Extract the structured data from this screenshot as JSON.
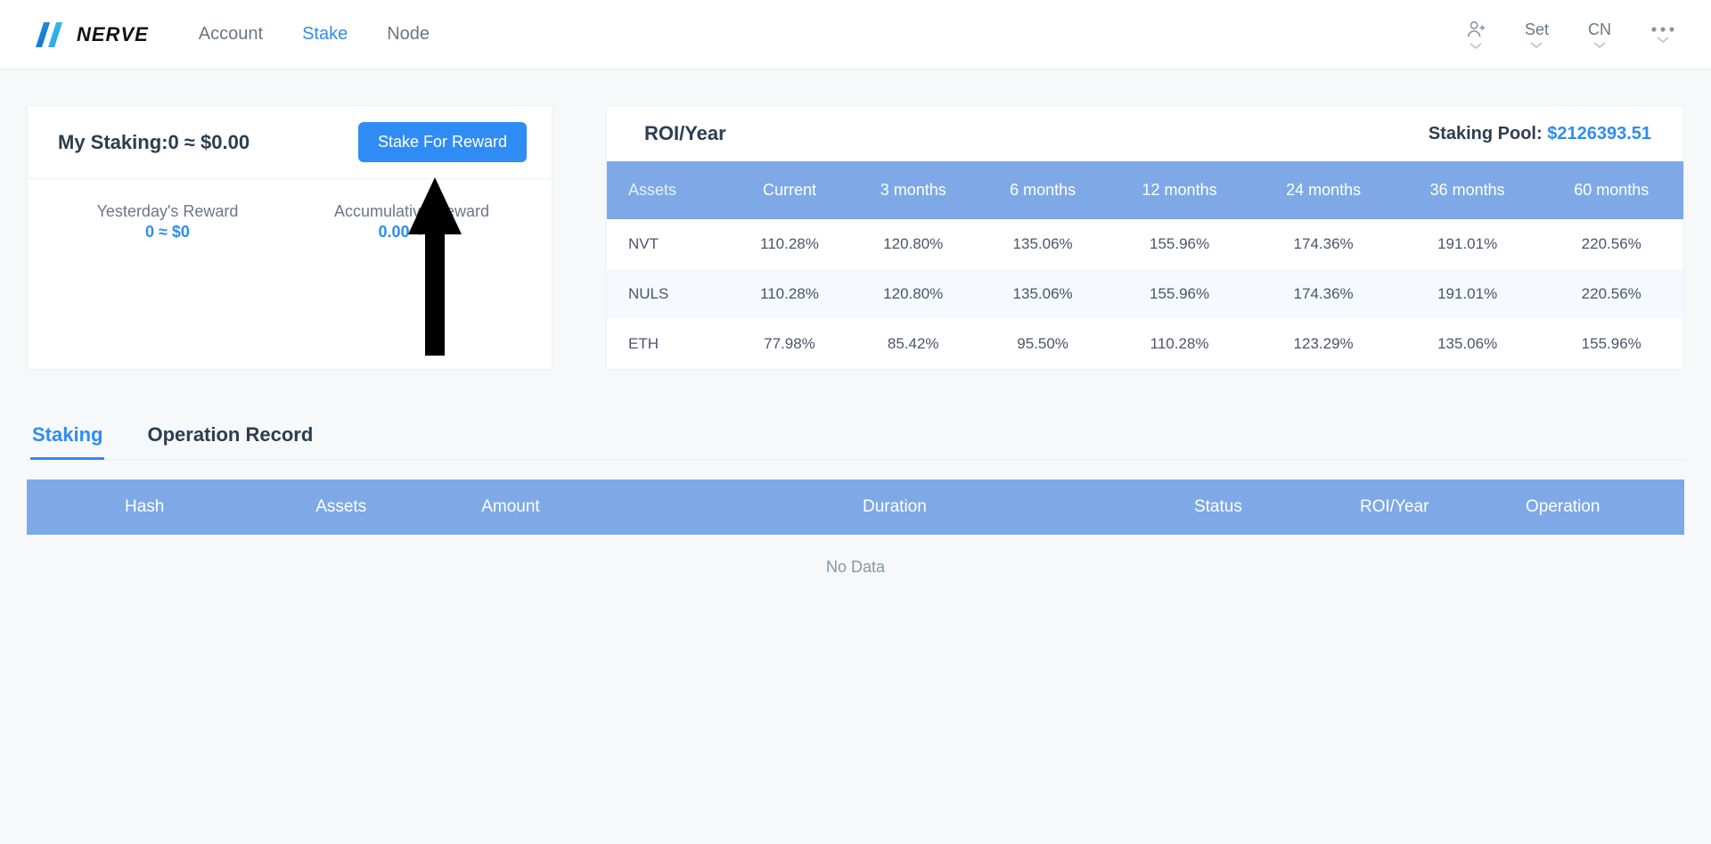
{
  "brand": {
    "name": "NERVE"
  },
  "nav": {
    "links": [
      {
        "label": "Account",
        "active": false
      },
      {
        "label": "Stake",
        "active": true
      },
      {
        "label": "Node",
        "active": false
      }
    ],
    "set": "Set",
    "lang": "CN"
  },
  "my_staking": {
    "title": "My Staking:0 ≈ $0.00",
    "button": "Stake For Reward",
    "yesterday_label": "Yesterday's Reward",
    "yesterday_value": "0 ≈ $0",
    "acc_label": "Accumulative Reward",
    "acc_value": "0.00 ≈ $0"
  },
  "roi": {
    "title": "ROI/Year",
    "pool_label": "Staking Pool: ",
    "pool_value": "$2126393.51",
    "headers": [
      "Assets",
      "Current",
      "3 months",
      "6 months",
      "12 months",
      "24 months",
      "36 months",
      "60 months"
    ],
    "rows": [
      {
        "asset": "NVT",
        "v": [
          "110.28%",
          "120.80%",
          "135.06%",
          "155.96%",
          "174.36%",
          "191.01%",
          "220.56%"
        ]
      },
      {
        "asset": "NULS",
        "v": [
          "110.28%",
          "120.80%",
          "135.06%",
          "155.96%",
          "174.36%",
          "191.01%",
          "220.56%"
        ]
      },
      {
        "asset": "ETH",
        "v": [
          "77.98%",
          "85.42%",
          "95.50%",
          "110.28%",
          "123.29%",
          "135.06%",
          "155.96%"
        ]
      }
    ]
  },
  "tabs": [
    {
      "label": "Staking",
      "active": true
    },
    {
      "label": "Operation Record",
      "active": false
    }
  ],
  "staking_table": {
    "headers": [
      "Hash",
      "Assets",
      "Amount",
      "Duration",
      "Status",
      "ROI/Year",
      "Operation"
    ],
    "empty": "No Data"
  },
  "chart_data": {
    "type": "table",
    "title": "ROI/Year",
    "columns": [
      "Assets",
      "Current",
      "3 months",
      "6 months",
      "12 months",
      "24 months",
      "36 months",
      "60 months"
    ],
    "series": [
      {
        "name": "NVT",
        "values": [
          110.28,
          120.8,
          135.06,
          155.96,
          174.36,
          191.01,
          220.56
        ]
      },
      {
        "name": "NULS",
        "values": [
          110.28,
          120.8,
          135.06,
          155.96,
          174.36,
          191.01,
          220.56
        ]
      },
      {
        "name": "ETH",
        "values": [
          77.98,
          85.42,
          95.5,
          110.28,
          123.29,
          135.06,
          155.96
        ]
      }
    ]
  }
}
